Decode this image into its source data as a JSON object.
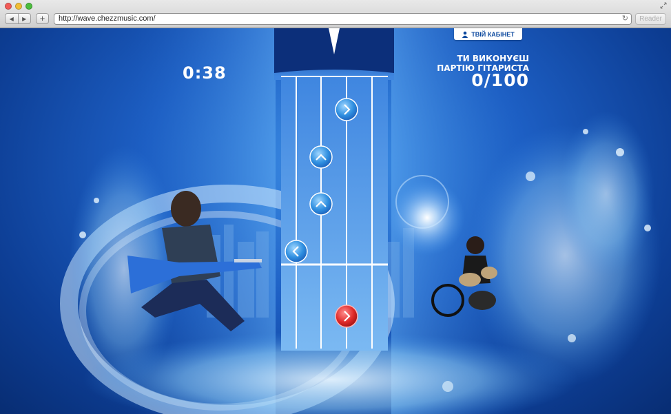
{
  "browser": {
    "url": "http://wave.chezzmusic.com/",
    "back_label": "◀",
    "forward_label": "▶",
    "add_label": "+",
    "reader_label": "Reader",
    "reload_icon": "↻"
  },
  "game": {
    "timer": "0:38",
    "cabinet_button": "ТВІЙ КАБІНЕТ",
    "role_line1": "ТИ ВИКОНУЄШ",
    "role_line2": "ПАРТІЮ ГІТАРИСТА",
    "score": "0/100",
    "notes": [
      {
        "icon": "chevron-right-icon",
        "color": "#2f8fe0",
        "glyph": "›"
      },
      {
        "icon": "chevron-up-icon",
        "color": "#2f8fe0",
        "glyph": "‹"
      },
      {
        "icon": "chevron-up-icon",
        "color": "#2f8fe0",
        "glyph": "‹"
      },
      {
        "icon": "chevron-left-icon",
        "color": "#2f8fe0",
        "glyph": "‹"
      },
      {
        "icon": "chevron-right-icon",
        "color": "#e02a2a",
        "glyph": "›"
      }
    ]
  },
  "colors": {
    "accent": "#0d4a9f",
    "hit_note": "#e02a2a"
  }
}
